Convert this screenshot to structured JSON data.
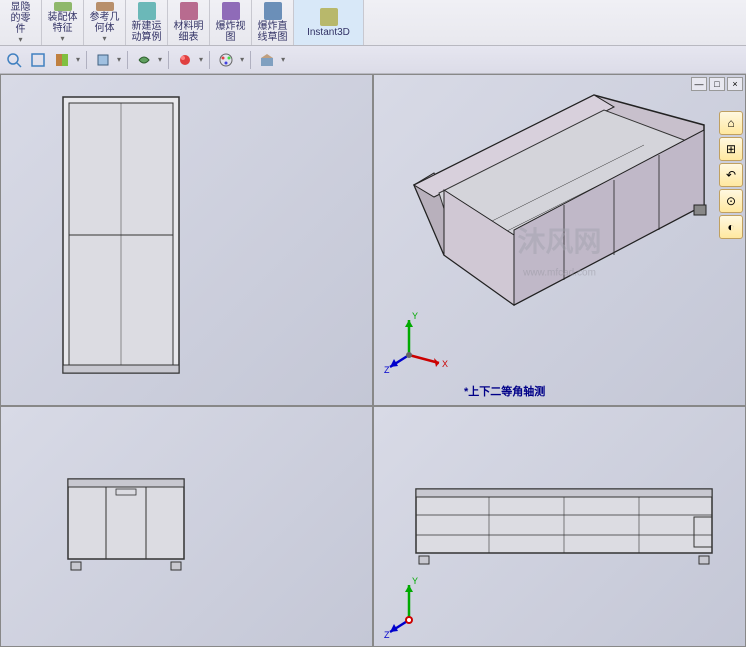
{
  "ribbon": {
    "items": [
      {
        "label": "显隐\n的零\n件",
        "arrow": true
      },
      {
        "label": "装配体\n特征",
        "arrow": true
      },
      {
        "label": "参考几\n何体",
        "arrow": true
      },
      {
        "label": "新建运\n动算例"
      },
      {
        "label": "材料明\n细表"
      },
      {
        "label": "爆炸视\n图"
      },
      {
        "label": "爆炸直\n线草图"
      },
      {
        "label": "Instant3D",
        "active": true
      }
    ]
  },
  "watermark": {
    "main": "沐风网",
    "sub": "www.mfcad.com"
  },
  "viewport": {
    "tr_label": "*上下二等角轴测",
    "axes": {
      "x": "X",
      "y": "Y",
      "z": "Z"
    }
  },
  "window_controls": {
    "min": "—",
    "max": "□",
    "close": "×"
  },
  "right_tools": [
    "⌂",
    "⊞",
    "↶",
    "⊙",
    "◐"
  ]
}
